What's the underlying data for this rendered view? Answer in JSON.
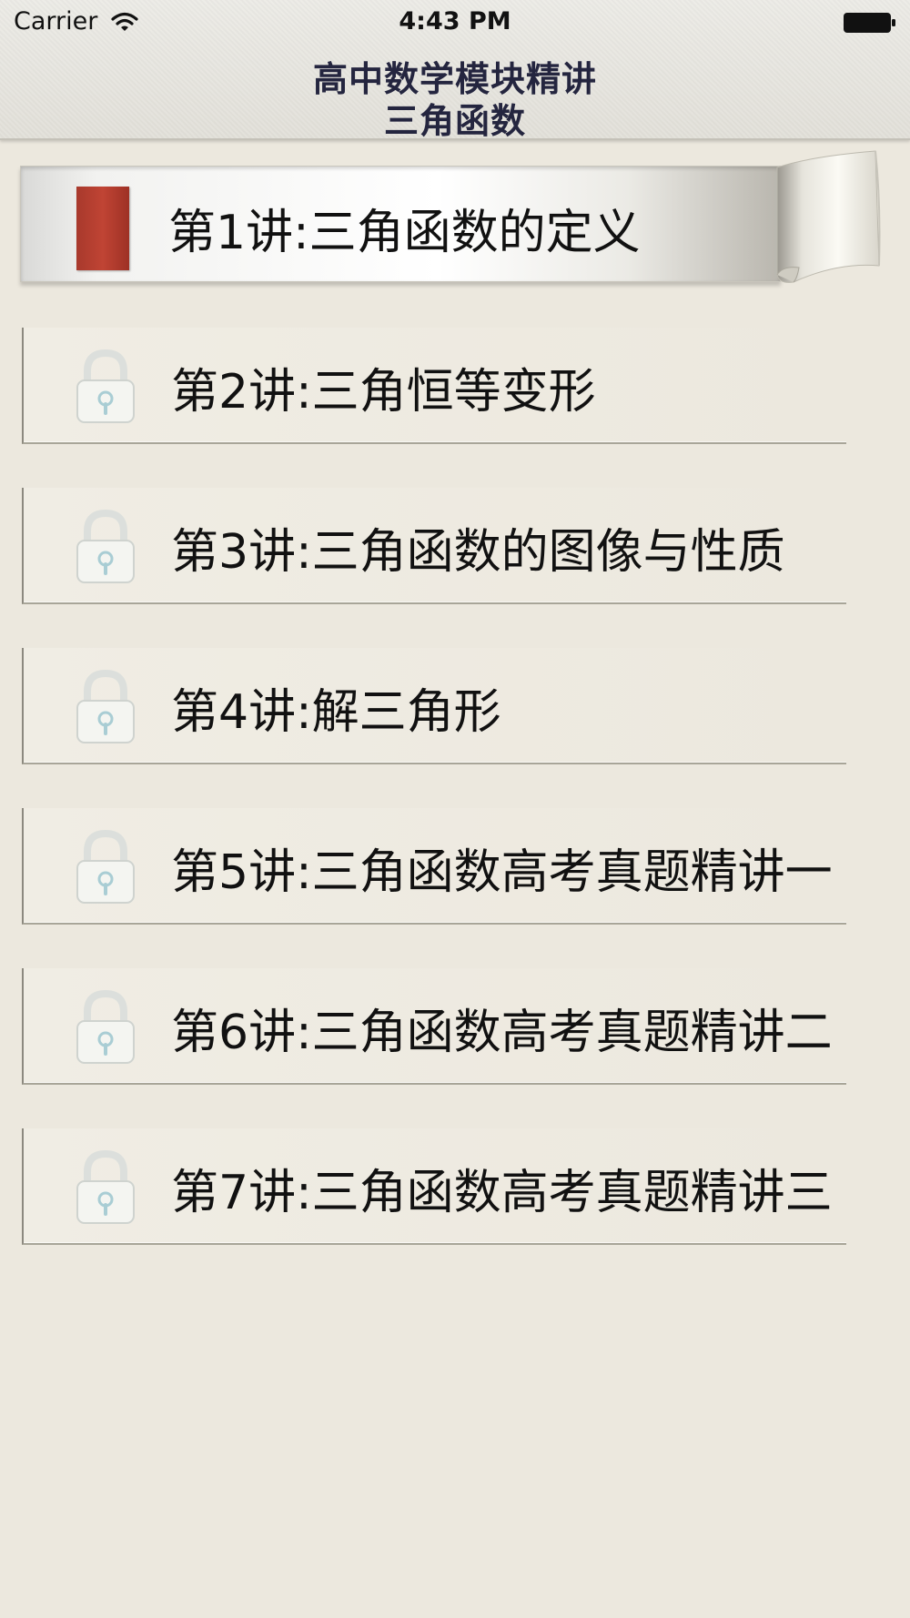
{
  "status_bar": {
    "carrier": "Carrier",
    "time": "4:43 PM",
    "wifi_icon": "wifi-icon",
    "battery_icon": "battery-icon"
  },
  "header": {
    "title": "高中数学模块精讲",
    "subtitle": "三角函数"
  },
  "lessons": [
    {
      "label": "第1讲:三角函数的定义",
      "state": "unlocked",
      "icon": "book-icon"
    },
    {
      "label": "第2讲:三角恒等变形",
      "state": "locked",
      "icon": "lock-icon"
    },
    {
      "label": "第3讲:三角函数的图像与性质",
      "state": "locked",
      "icon": "lock-icon"
    },
    {
      "label": "第4讲:解三角形",
      "state": "locked",
      "icon": "lock-icon"
    },
    {
      "label": "第5讲:三角函数高考真题精讲一",
      "state": "locked",
      "icon": "lock-icon"
    },
    {
      "label": "第6讲:三角函数高考真题精讲二",
      "state": "locked",
      "icon": "lock-icon"
    },
    {
      "label": "第7讲:三角函数高考真题精讲三",
      "state": "locked",
      "icon": "lock-icon"
    }
  ],
  "colors": {
    "background": "#ece8de",
    "title_text": "#24253f",
    "book_red": "#b33e30"
  }
}
